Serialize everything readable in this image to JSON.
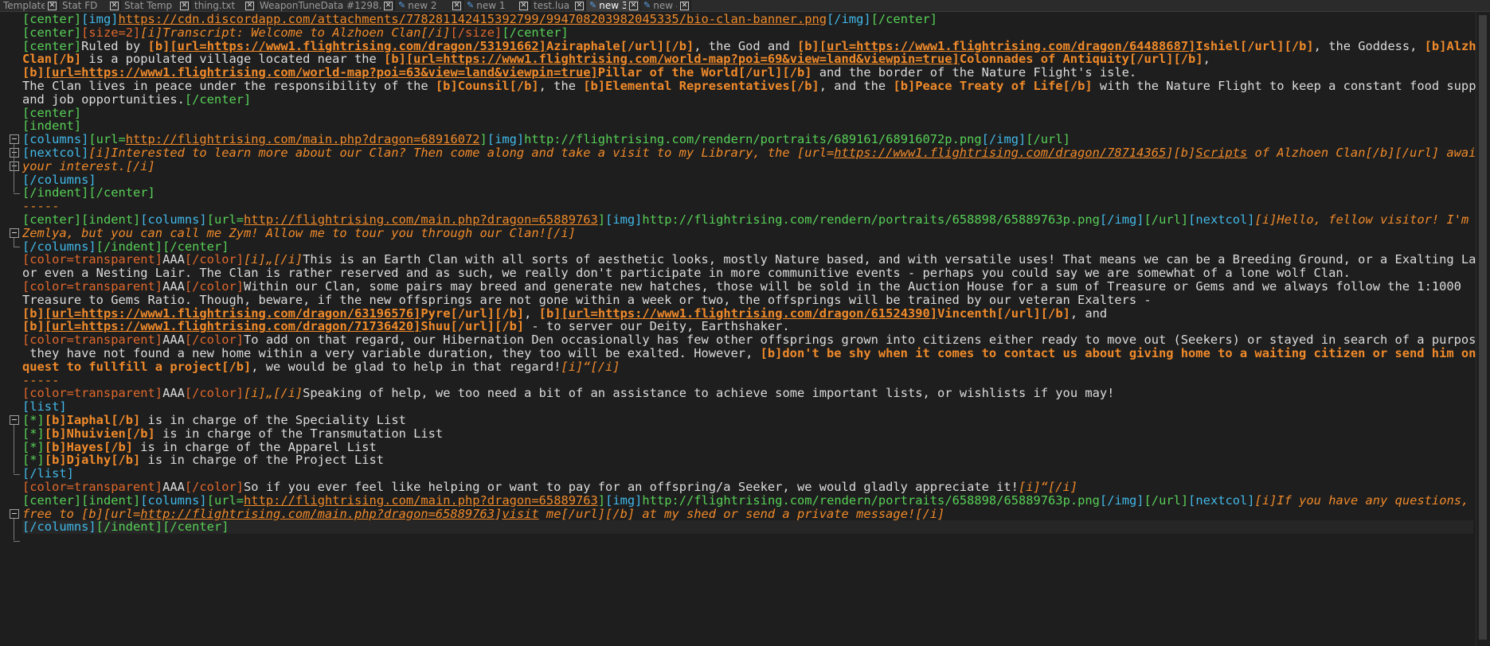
{
  "tabs": [
    {
      "label": "Template",
      "modified": false,
      "active": false
    },
    {
      "label": "Stat FD",
      "modified": false,
      "active": false
    },
    {
      "label": "Stat Temp",
      "modified": false,
      "active": false
    },
    {
      "label": "thing.txt",
      "modified": false,
      "active": false
    },
    {
      "label": "WeaponTuneData #1298.json",
      "modified": false,
      "active": false
    },
    {
      "label": "new 2",
      "modified": true,
      "active": false
    },
    {
      "label": "new 1",
      "modified": true,
      "active": false
    },
    {
      "label": "test.lua",
      "modified": false,
      "active": false
    },
    {
      "label": "new 3",
      "modified": true,
      "active": true
    },
    {
      "label": "new 4",
      "modified": true,
      "active": false
    }
  ],
  "tab_close_glyph": "✕",
  "tab_modified_icon": "pencil-icon",
  "fold_markers": [
    {
      "line": 10
    },
    {
      "line": 11
    },
    {
      "line": 12
    },
    {
      "line": 17
    },
    {
      "line": 31
    },
    {
      "line": 38
    }
  ],
  "lines": [
    {
      "segs": [
        [
          "g",
          "[center]"
        ],
        [
          "c",
          "[img]"
        ],
        [
          "ou",
          "https://cdn.discordapp.com/attachments/778281142415392799/994708203982045335/bio-clan-banner.png"
        ],
        [
          "c",
          "[/img]"
        ],
        [
          "g",
          "[/center]"
        ]
      ]
    },
    {
      "segs": [
        [
          "g",
          "[center]"
        ],
        [
          "r",
          "[size=2]"
        ],
        [
          "oi",
          "[i]Transcript: Welcome to Alzhoen Clan[/i]"
        ],
        [
          "r",
          "[/size]"
        ],
        [
          "g",
          "[/center]"
        ]
      ]
    },
    {
      "segs": [
        [
          "g",
          "[center]"
        ],
        [
          "t",
          "Ruled by "
        ],
        [
          "ob",
          "[b]"
        ],
        [
          "oub",
          "[url=https://www1.flightrising.com/dragon/53191662]"
        ],
        [
          "ob",
          "Aziraphale[/url][/b]"
        ],
        [
          "t",
          ", the God and "
        ],
        [
          "ob",
          "[b]"
        ],
        [
          "oub",
          "[url=https://www1.flightrising.com/dragon/64488687]"
        ],
        [
          "ob",
          "Ishiel[/url][/b]"
        ],
        [
          "t",
          ", the Goddess, "
        ],
        [
          "ob",
          "[b]Alzhoen"
        ]
      ]
    },
    {
      "segs": [
        [
          "ob",
          "Clan[/b]"
        ],
        [
          "t",
          " is a populated village located near the "
        ],
        [
          "ob",
          "[b]"
        ],
        [
          "oub",
          "[url=https://www1.flightrising.com/world-map?poi=69&view=land&viewpin=true]"
        ],
        [
          "ob",
          "Colonnades of Antiquity[/url][/b]"
        ],
        [
          "t",
          ","
        ]
      ]
    },
    {
      "segs": [
        [
          "ob",
          "[b]"
        ],
        [
          "oub",
          "[url=https://www1.flightrising.com/world-map?poi=63&view=land&viewpin=true]"
        ],
        [
          "ob",
          "Pillar of the World[/url][/b]"
        ],
        [
          "t",
          " and the border of the Nature Flight's isle."
        ]
      ]
    },
    {
      "segs": [
        [
          "t",
          "The Clan lives in peace under the responsibility of the "
        ],
        [
          "ob",
          "[b]Counsil[/b]"
        ],
        [
          "t",
          ", the "
        ],
        [
          "ob",
          "[b]Elemental Representatives[/b]"
        ],
        [
          "t",
          ", and the "
        ],
        [
          "ob",
          "[b]Peace Treaty of Life[/b]"
        ],
        [
          "t",
          " with the Nature Flight to keep a constant food supply"
        ]
      ]
    },
    {
      "segs": [
        [
          "t",
          "and job opportunities."
        ],
        [
          "g",
          "[/center]"
        ]
      ]
    },
    {
      "segs": [
        [
          "g",
          "[center]"
        ]
      ]
    },
    {
      "segs": [
        [
          "g",
          "[indent]"
        ]
      ]
    },
    {
      "segs": [
        [
          "c",
          "[columns]"
        ],
        [
          "g",
          "[url="
        ],
        [
          "ou",
          "http://flightrising.com/main.php?dragon=68916072"
        ],
        [
          "g",
          "]"
        ],
        [
          "c",
          "[img]"
        ],
        [
          "g",
          "http://flightrising.com/rendern/portraits/689161/68916072p.png"
        ],
        [
          "c",
          "[/img]"
        ],
        [
          "g",
          "[/url]"
        ]
      ]
    },
    {
      "segs": [
        [
          "c",
          "[nextcol]"
        ],
        [
          "oi",
          "[i]Interested to learn more about our Clan? Then come along and take a visit to my Library, the [url="
        ],
        [
          "ouit",
          "https://www1.flightrising.com/dragon/78714365"
        ],
        [
          "oi",
          "][b]"
        ],
        [
          "ouit",
          "Scripts"
        ],
        [
          "oi",
          " of Alzhoen Clan[/b][/url] await"
        ]
      ]
    },
    {
      "segs": [
        [
          "oi",
          "your interest.[/i]"
        ]
      ]
    },
    {
      "segs": [
        [
          "c",
          "[/columns]"
        ]
      ]
    },
    {
      "segs": [
        [
          "g",
          "[/indent]"
        ],
        [
          "g",
          "[/center]"
        ]
      ]
    },
    {
      "segs": [
        [
          "o",
          "-----"
        ]
      ]
    },
    {
      "segs": [
        [
          "g",
          "[center]"
        ],
        [
          "g",
          "[indent]"
        ],
        [
          "c",
          "[columns]"
        ],
        [
          "g",
          "[url="
        ],
        [
          "ou",
          "http://flightrising.com/main.php?dragon=65889763"
        ],
        [
          "g",
          "]"
        ],
        [
          "c",
          "[img]"
        ],
        [
          "g",
          "http://flightrising.com/rendern/portraits/658898/65889763p.png"
        ],
        [
          "c",
          "[/img]"
        ],
        [
          "g",
          "[/url]"
        ],
        [
          "c",
          "[nextcol]"
        ],
        [
          "oi",
          "[i]Hello, fellow visitor! I'm"
        ]
      ]
    },
    {
      "segs": [
        [
          "oi",
          "Zemlya, but you can call me Zym! Allow me to tour you through our Clan![/i]"
        ]
      ]
    },
    {
      "segs": [
        [
          "c",
          "[/columns]"
        ],
        [
          "g",
          "[/indent]"
        ],
        [
          "g",
          "[/center]"
        ]
      ]
    },
    {
      "segs": [
        [
          "r",
          "[color=transparent]"
        ],
        [
          "t",
          "AAA"
        ],
        [
          "r",
          "[/color]"
        ],
        [
          "oi",
          "[i]„[/i]"
        ],
        [
          "t",
          "This is an Earth Clan with all sorts of aesthetic looks, mostly Nature based, and with versatile uses! That means we can be a Breeding Ground, or a Exalting Lair,"
        ]
      ]
    },
    {
      "segs": [
        [
          "t",
          "or even a Nesting Lair. The Clan is rather reserved and as such, we really don't participate in more communitive events - perhaps you could say we are somewhat of a lone wolf Clan."
        ]
      ]
    },
    {
      "segs": [
        [
          "r",
          "[color=transparent]"
        ],
        [
          "t",
          "AAA"
        ],
        [
          "r",
          "[/color]"
        ],
        [
          "t",
          "Within our Clan, some pairs may breed and generate new hatches, those will be sold in the Auction House for a sum of Treasure or Gems and we always follow the 1:1000"
        ]
      ]
    },
    {
      "segs": [
        [
          "t",
          "Treasure to Gems Ratio. Though, beware, if the new offsprings are not gone within a week or two, the offsprings will be trained by our veteran Exalters -"
        ]
      ]
    },
    {
      "segs": [
        [
          "ob",
          "[b]"
        ],
        [
          "oub",
          "[url=https://www1.flightrising.com/dragon/63196576]"
        ],
        [
          "ob",
          "Pyre[/url][/b]"
        ],
        [
          "t",
          ", "
        ],
        [
          "ob",
          "[b]"
        ],
        [
          "oub",
          "[url=https://www1.flightrising.com/dragon/61524390]"
        ],
        [
          "ob",
          "Vincenth[/url][/b]"
        ],
        [
          "t",
          ", and"
        ]
      ]
    },
    {
      "segs": [
        [
          "ob",
          "[b]"
        ],
        [
          "oub",
          "[url=https://www1.flightrising.com/dragon/71736420]"
        ],
        [
          "ob",
          "Shuu[/url][/b]"
        ],
        [
          "t",
          " - to server our Deity, Earthshaker."
        ]
      ]
    },
    {
      "segs": [
        [
          "r",
          "[color=transparent]"
        ],
        [
          "t",
          "AAA"
        ],
        [
          "r",
          "[/color]"
        ],
        [
          "t",
          "To add on that regard, our Hibernation Den occasionally has few other offsprings grown into citizens either ready to move out (Seekers) or stayed in search of a purpose. If"
        ]
      ]
    },
    {
      "segs": [
        [
          "t",
          " they have not found a new home within a very variable duration, they too will be exalted. However, "
        ],
        [
          "ob",
          "[b]don't be shy when it comes to contact us about giving home to a waiting citizen or send him on a"
        ]
      ]
    },
    {
      "segs": [
        [
          "ob",
          "quest to fullfill a project[/b]"
        ],
        [
          "t",
          ", we would be glad to help in that regard!"
        ],
        [
          "oi",
          "[i]“[/i]"
        ]
      ]
    },
    {
      "segs": [
        [
          "o",
          "-----"
        ]
      ]
    },
    {
      "segs": [
        [
          "r",
          "[color=transparent]"
        ],
        [
          "t",
          "AAA"
        ],
        [
          "r",
          "[/color]"
        ],
        [
          "oi",
          "[i]„[/i]"
        ],
        [
          "t",
          "Speaking of help, we too need a bit of an assistance to achieve some important lists, or wishlists if you may!"
        ]
      ]
    },
    {
      "segs": [
        [
          "c",
          "[list]"
        ]
      ]
    },
    {
      "segs": [
        [
          "g",
          "[*]"
        ],
        [
          "ob",
          "[b]Iaphal[/b]"
        ],
        [
          "t",
          " is in charge of the Speciality List"
        ]
      ]
    },
    {
      "segs": [
        [
          "g",
          "[*]"
        ],
        [
          "ob",
          "[b]Nhuivien[/b]"
        ],
        [
          "t",
          " is in charge of the Transmutation List"
        ]
      ]
    },
    {
      "segs": [
        [
          "g",
          "[*]"
        ],
        [
          "ob",
          "[b]Hayes[/b]"
        ],
        [
          "t",
          " is in charge of the Apparel List"
        ]
      ]
    },
    {
      "segs": [
        [
          "g",
          "[*]"
        ],
        [
          "ob",
          "[b]Djalhy[/b]"
        ],
        [
          "t",
          " is in charge of the Project List"
        ]
      ]
    },
    {
      "segs": [
        [
          "c",
          "[/list]"
        ]
      ]
    },
    {
      "segs": [
        [
          "r",
          "[color=transparent]"
        ],
        [
          "t",
          "AAA"
        ],
        [
          "r",
          "[/color]"
        ],
        [
          "t",
          "So if you ever feel like helping or want to pay for an offspring/a Seeker, we would gladly appreciate it!"
        ],
        [
          "oi",
          "[i]“[/i]"
        ]
      ]
    },
    {
      "segs": [
        [
          "g",
          "[center]"
        ],
        [
          "g",
          "[indent]"
        ],
        [
          "c",
          "[columns]"
        ],
        [
          "g",
          "[url="
        ],
        [
          "ou",
          "http://flightrising.com/main.php?dragon=65889763"
        ],
        [
          "g",
          "]"
        ],
        [
          "c",
          "[img]"
        ],
        [
          "g",
          "http://flightrising.com/rendern/portraits/658898/65889763p.png"
        ],
        [
          "c",
          "[/img]"
        ],
        [
          "g",
          "[/url]"
        ],
        [
          "c",
          "[nextcol]"
        ],
        [
          "oi",
          "[i]If you have any questions, feel"
        ]
      ]
    },
    {
      "segs": [
        [
          "oi",
          "free to [b][url="
        ],
        [
          "ouit",
          "http://flightrising.com/main.php?dragon=65889763"
        ],
        [
          "oi",
          "]"
        ],
        [
          "ouit",
          "visit"
        ],
        [
          "oi",
          " me[/url][/b] at my shed or send a private message![/i]"
        ]
      ]
    },
    {
      "segs": [
        [
          "c",
          "[/columns]"
        ],
        [
          "g",
          "[/indent]"
        ],
        [
          "g",
          "[/center]"
        ]
      ]
    }
  ]
}
